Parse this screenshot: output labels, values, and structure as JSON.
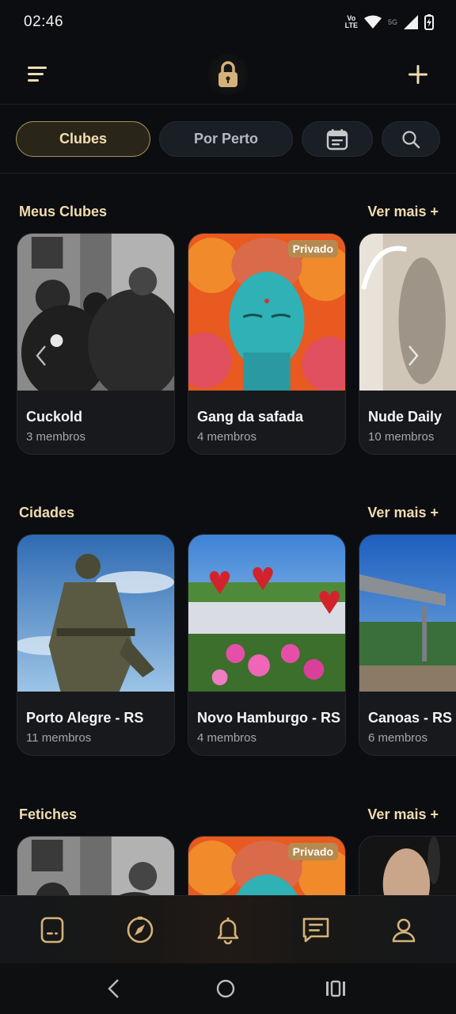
{
  "status_bar": {
    "time": "02:46",
    "volte_line1": "Vo",
    "volte_line2": "LTE",
    "network": "5G",
    "icons": [
      "wifi-icon",
      "signal-icon",
      "battery-charging-icon"
    ]
  },
  "top_bar": {
    "menu_icon": "menu-icon",
    "logo_icon": "lock-icon",
    "add_icon": "plus-icon"
  },
  "filters": {
    "chips": [
      {
        "label": "Clubes",
        "active": true
      },
      {
        "label": "Por Perto",
        "active": false
      }
    ],
    "calendar_icon": "calendar-icon",
    "search_icon": "search-icon"
  },
  "sections": [
    {
      "title": "Meus Clubes",
      "see_more": "Ver mais +",
      "cards": [
        {
          "title": "Cuckold",
          "subtitle": "3 membros",
          "badge": ""
        },
        {
          "title": "Gang da safada",
          "subtitle": "4 membros",
          "badge": "Privado"
        },
        {
          "title": "Nude Daily",
          "subtitle": "10 membros",
          "badge": ""
        }
      ]
    },
    {
      "title": "Cidades",
      "see_more": "Ver mais +",
      "cards": [
        {
          "title": "Porto Alegre - RS",
          "subtitle": "11 membros",
          "badge": ""
        },
        {
          "title": "Novo Hamburgo - RS",
          "subtitle": "4 membros",
          "badge": ""
        },
        {
          "title": "Canoas - RS",
          "subtitle": "6 membros",
          "badge": ""
        }
      ]
    },
    {
      "title": "Fetiches",
      "see_more": "Ver mais +",
      "cards": [
        {
          "title": "",
          "subtitle": "",
          "badge": ""
        },
        {
          "title": "",
          "subtitle": "",
          "badge": "Privado"
        },
        {
          "title": "",
          "subtitle": "",
          "badge": ""
        }
      ]
    }
  ],
  "bottom_nav": {
    "items": [
      "feed-icon",
      "compass-icon",
      "bell-icon",
      "chat-icon",
      "profile-icon"
    ]
  },
  "system_nav": {
    "items": [
      "back-icon",
      "home-icon",
      "recents-icon"
    ]
  },
  "colors": {
    "background": "#0b0d10",
    "accent": "#f0dcb0",
    "gold": "#d4b27a",
    "badge": "#b58a50"
  }
}
